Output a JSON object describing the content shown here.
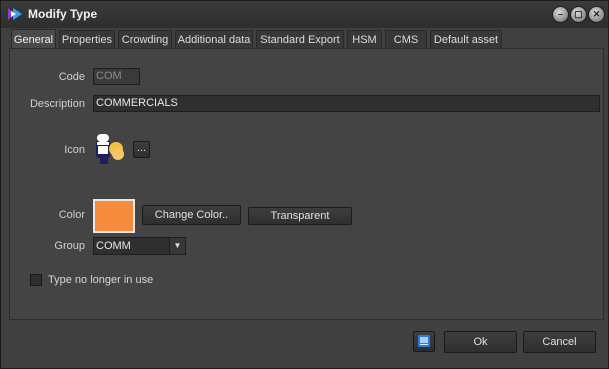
{
  "window": {
    "title": "Modify Type"
  },
  "tabs": [
    {
      "label": "General",
      "active": true
    },
    {
      "label": "Properties"
    },
    {
      "label": "Crowding"
    },
    {
      "label": "Additional data"
    },
    {
      "label": "Standard Export"
    },
    {
      "label": "HSM"
    },
    {
      "label": "CMS"
    },
    {
      "label": "Default asset"
    }
  ],
  "form": {
    "code_label": "Code",
    "code_value": "COM",
    "description_label": "Description",
    "description_value": "COMMERCIALS",
    "icon_label": "Icon",
    "icon_browse_label": "...",
    "color_label": "Color",
    "color_value": "#f58b3c",
    "change_color_label": "Change Color..",
    "transparent_label": "Transparent",
    "group_label": "Group",
    "group_value": "COMM",
    "no_longer_in_use_label": "Type no longer in use",
    "no_longer_in_use_checked": false
  },
  "footer": {
    "ok_label": "Ok",
    "cancel_label": "Cancel"
  },
  "colors": {
    "window_bg": "#404040",
    "field_bg": "#2f2f2f",
    "accent_blue": "#2a7bd8"
  }
}
